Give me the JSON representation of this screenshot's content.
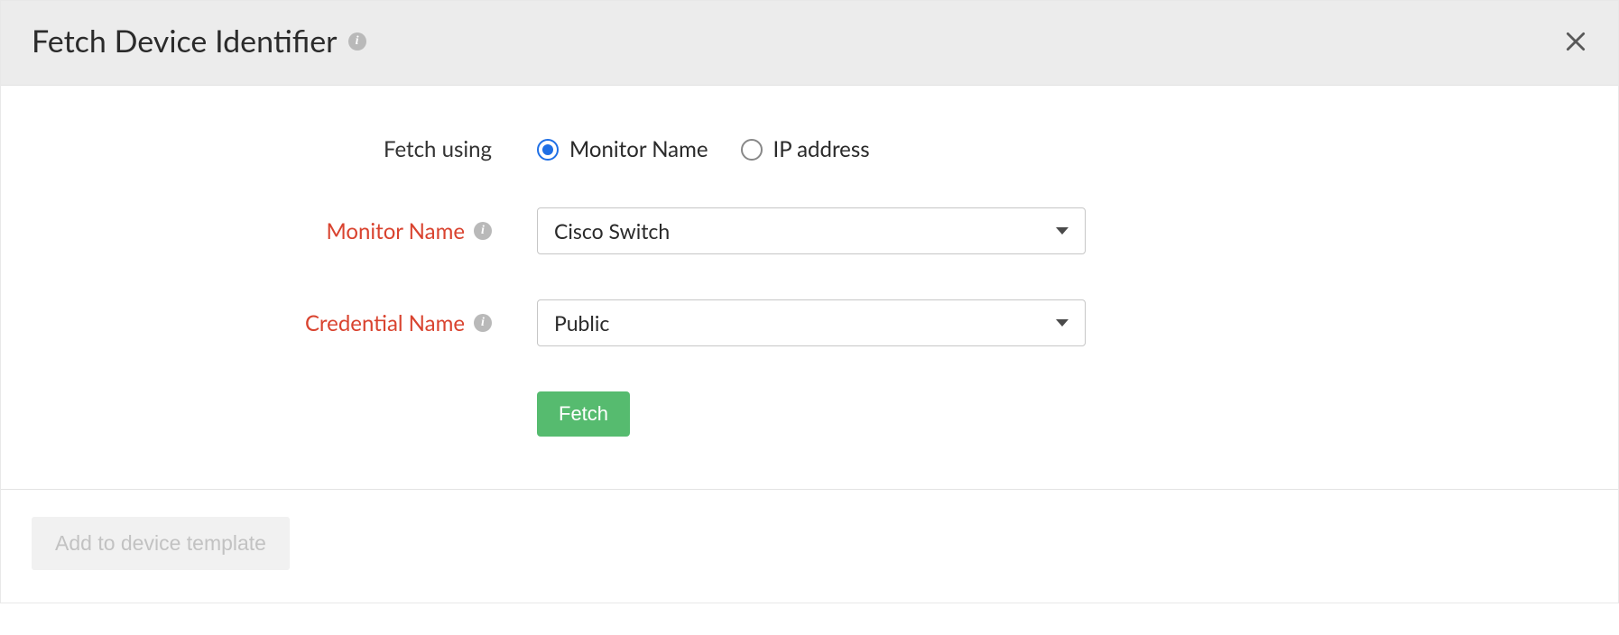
{
  "dialog": {
    "title": "Fetch Device Identifier"
  },
  "form": {
    "fetch_using_label": "Fetch using",
    "radio_monitor_name": "Monitor Name",
    "radio_ip_address": "IP address",
    "monitor_name_label": "Monitor Name",
    "monitor_name_value": "Cisco Switch",
    "credential_name_label": "Credential Name",
    "credential_name_value": "Public",
    "fetch_button": "Fetch"
  },
  "footer": {
    "add_to_template": "Add to device template"
  },
  "icons": {
    "info_glyph": "i"
  }
}
